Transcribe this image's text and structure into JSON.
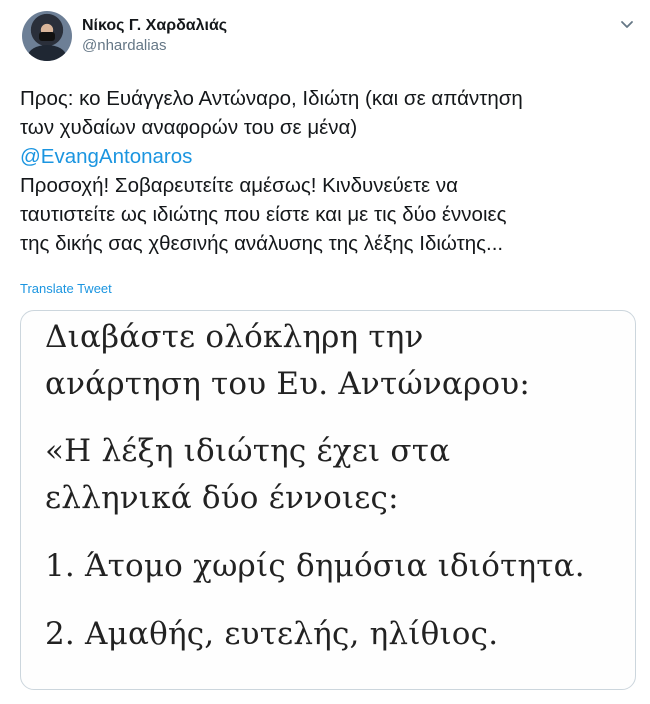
{
  "author": {
    "name": "Νίκος Γ. Χαρδαλιάς",
    "handle": "@nhardalias"
  },
  "icons": {
    "menu": "chevron-down-icon"
  },
  "tweet": {
    "lines": [
      "Προς: κο Ευάγγελο Αντώναρο, Ιδιώτη (και σε απάντηση",
      "των χυδαίων αναφορών του σε μένα)"
    ],
    "mention": "@EvangAntonaros",
    "lines2": [
      "Προσοχή! Σοβαρευτείτε αμέσως! Κινδυνεύετε να",
      "ταυτιστείτε ως ιδιώτης που είστε και με τις δύο έννοιες",
      "της δικής σας χθεσινής ανάλυσης της λέξης Ιδιώτης..."
    ],
    "translate_label": "Translate Tweet"
  },
  "media": {
    "lines": [
      "Διαβάστε ολόκληρη την",
      "ανάρτηση του Ευ. Αντώναρου:",
      "«Η λέξη ιδιώτης έχει στα",
      "ελληνικά δύο έννοιες:",
      "1. Άτομο χωρίς δημόσια ιδιότητα.",
      "2. Αμαθής, ευτελής, ηλίθιος."
    ]
  },
  "colors": {
    "link": "#1b95e0",
    "secondary": "#657786",
    "text": "#14171a",
    "border": "#ccd6dd"
  }
}
